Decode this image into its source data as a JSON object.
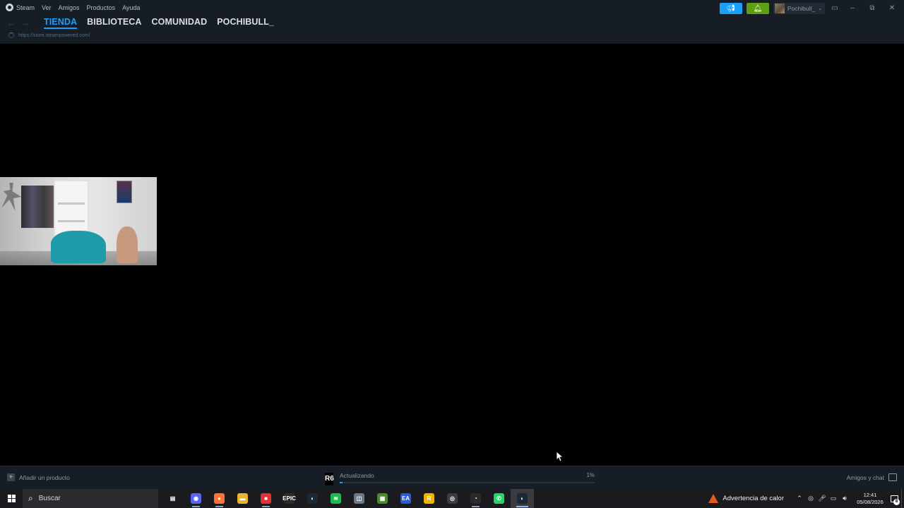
{
  "steam": {
    "menu": [
      "Steam",
      "Ver",
      "Amigos",
      "Productos",
      "Ayuda"
    ],
    "tabs": [
      "TIENDA",
      "BIBLIOTECA",
      "COMUNIDAD",
      "POCHIBULL_"
    ],
    "active_tab": "TIENDA",
    "url": "https://store.steampowered.com/",
    "user_name": "Pochibull_",
    "colors": {
      "accent": "#1a9fff",
      "notification": "#5c9e14",
      "chrome": "#171d25"
    }
  },
  "bottom": {
    "add_product": "Añadir un producto",
    "download_icon": "R6",
    "download_status": "Actualizando",
    "download_percent_label": "1%",
    "download_progress": 0.01,
    "friends_chat": "Amigos y chat"
  },
  "taskbar": {
    "search_placeholder": "Buscar",
    "apps": [
      {
        "name": "task-view",
        "glyph": "▤",
        "color": "#1b1b1f"
      },
      {
        "name": "discord",
        "glyph": "◉",
        "color": "#5865f2"
      },
      {
        "name": "firefox",
        "glyph": "●",
        "color": "#ff7139"
      },
      {
        "name": "file-explorer",
        "glyph": "▬",
        "color": "#e8b52e"
      },
      {
        "name": "red-app",
        "glyph": "■",
        "color": "#e23237"
      },
      {
        "name": "epic-games",
        "glyph": "EPIC",
        "color": "#2a2a2a"
      },
      {
        "name": "steam-small",
        "glyph": "◐",
        "color": "#1b2838"
      },
      {
        "name": "spotify",
        "glyph": "≋",
        "color": "#1db954"
      },
      {
        "name": "app-grey",
        "glyph": "◫",
        "color": "#6a7a8a"
      },
      {
        "name": "minecraft",
        "glyph": "▦",
        "color": "#4a8a2a"
      },
      {
        "name": "ea-app",
        "glyph": "EA",
        "color": "#2a5ad8"
      },
      {
        "name": "rockstar",
        "glyph": "R",
        "color": "#f2b300"
      },
      {
        "name": "obs",
        "glyph": "◎",
        "color": "#3a3a40"
      },
      {
        "name": "app-red-circle",
        "glyph": "◔",
        "color": "#2a2a2a"
      },
      {
        "name": "whatsapp",
        "glyph": "✆",
        "color": "#25d366"
      },
      {
        "name": "steam",
        "glyph": "◐",
        "color": "#1b2838"
      }
    ],
    "heat_warning": "Advertencia de calor",
    "time": "12:41",
    "date": "05/08/2026",
    "notification_count": "8"
  }
}
